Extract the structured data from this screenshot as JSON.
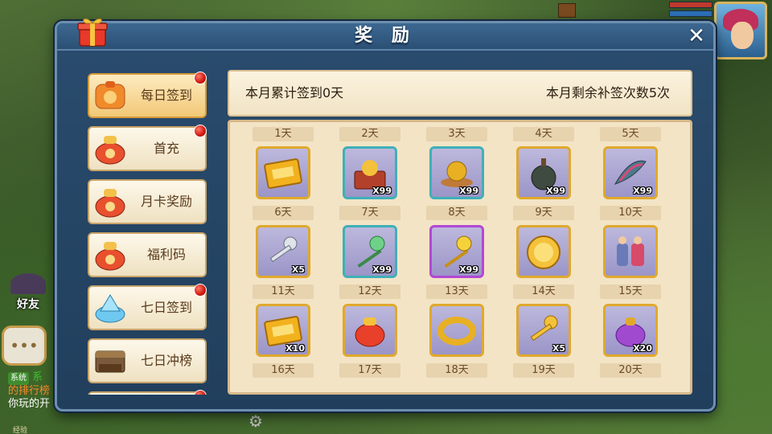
{
  "hud": {
    "friends_label": "好友",
    "chat_tag": "系统",
    "chat_lines": [
      "系",
      "的排行榜",
      "你玩的开"
    ],
    "exp_label": "经验"
  },
  "dialog": {
    "title": "奖 励",
    "close_glyph": "✕"
  },
  "sidebar": {
    "items": [
      {
        "label": "每日签到",
        "icon": "lucky-bag-icon",
        "active": true,
        "badge": true
      },
      {
        "label": "首充",
        "icon": "money-bag-icon",
        "active": false,
        "badge": true
      },
      {
        "label": "月卡奖励",
        "icon": "money-bag-icon",
        "active": false,
        "badge": false
      },
      {
        "label": "福利码",
        "icon": "money-bag-icon",
        "active": false,
        "badge": false
      },
      {
        "label": "七日签到",
        "icon": "crystal-icon",
        "active": false,
        "badge": true
      },
      {
        "label": "七日冲榜",
        "icon": "ranking-chest-icon",
        "active": false,
        "badge": false
      },
      {
        "label": "",
        "icon": "money-bag-icon",
        "active": false,
        "badge": true
      }
    ]
  },
  "info": {
    "left": "本月累计签到0天",
    "right": "本月剩余补签次数5次"
  },
  "grid": {
    "cells": [
      {
        "day": "1天",
        "icon": "vip-card-icon",
        "qty": "",
        "quality": "gold"
      },
      {
        "day": "2天",
        "icon": "treasure-box-icon",
        "qty": "X99",
        "quality": "teal"
      },
      {
        "day": "3天",
        "icon": "gold-ore-icon",
        "qty": "X99",
        "quality": "teal"
      },
      {
        "day": "4天",
        "icon": "gourd-icon",
        "qty": "X99",
        "quality": "gold"
      },
      {
        "day": "5天",
        "icon": "feather-gem-icon",
        "qty": "X99",
        "quality": "gold"
      },
      {
        "day": "6天",
        "icon": "silver-key-icon",
        "qty": "X5",
        "quality": "gold"
      },
      {
        "day": "7天",
        "icon": "magic-wand-icon",
        "qty": "X99",
        "quality": "teal"
      },
      {
        "day": "8天",
        "icon": "gold-wand-icon",
        "qty": "X99",
        "quality": "purple"
      },
      {
        "day": "9天",
        "icon": "gold-coin-icon",
        "qty": "",
        "quality": "gold"
      },
      {
        "day": "10天",
        "icon": "costume-icon",
        "qty": "",
        "quality": "gold"
      },
      {
        "day": "11天",
        "icon": "vip-card-icon",
        "qty": "X10",
        "quality": "gold"
      },
      {
        "day": "12天",
        "icon": "lucky-bag-icon",
        "qty": "",
        "quality": "gold"
      },
      {
        "day": "13天",
        "icon": "gold-ring-icon",
        "qty": "",
        "quality": "gold"
      },
      {
        "day": "14天",
        "icon": "gold-key-icon",
        "qty": "X5",
        "quality": "gold"
      },
      {
        "day": "15天",
        "icon": "purple-pouch-icon",
        "qty": "X20",
        "quality": "gold"
      },
      {
        "day": "16天",
        "icon": "",
        "qty": "",
        "quality": ""
      },
      {
        "day": "17天",
        "icon": "",
        "qty": "",
        "quality": ""
      },
      {
        "day": "18天",
        "icon": "",
        "qty": "",
        "quality": ""
      },
      {
        "day": "19天",
        "icon": "",
        "qty": "",
        "quality": ""
      },
      {
        "day": "20天",
        "icon": "",
        "qty": "",
        "quality": ""
      }
    ]
  },
  "colors": {
    "dialog_bg": "#2a4c6e",
    "panel_bg": "#f3e4c6",
    "badge_red": "#d0180f",
    "frame_gold": "#e0a92c",
    "frame_teal": "#3fb0b8",
    "frame_purple": "#b347d6"
  }
}
